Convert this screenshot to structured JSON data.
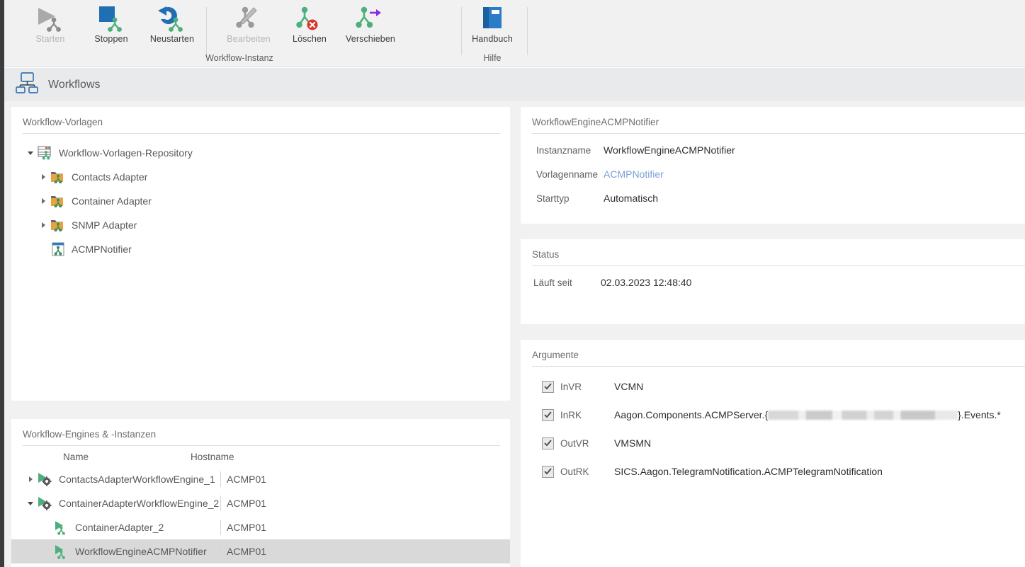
{
  "ribbon": {
    "groups": [
      {
        "title": "Workflow-Instanz",
        "buttons": [
          {
            "label": "Starten",
            "icon": "play-workflow-icon",
            "disabled": true
          },
          {
            "label": "Stoppen",
            "icon": "stop-workflow-icon",
            "disabled": false
          },
          {
            "label": "Neustarten",
            "icon": "restart-workflow-icon",
            "disabled": false
          },
          {
            "label": "Bearbeiten",
            "icon": "edit-workflow-icon",
            "disabled": true
          },
          {
            "label": "Löschen",
            "icon": "delete-workflow-icon",
            "disabled": false
          },
          {
            "label": "Verschieben",
            "icon": "move-workflow-icon",
            "disabled": false
          }
        ]
      },
      {
        "title": "Hilfe",
        "buttons": [
          {
            "label": "Handbuch",
            "icon": "manual-book-icon",
            "disabled": false
          }
        ]
      }
    ]
  },
  "page_header": {
    "title": "Workflows",
    "icon": "workflow-hierarchy-icon"
  },
  "templates_panel": {
    "title": "Workflow-Vorlagen",
    "tree": [
      {
        "label": "Workflow-Vorlagen-Repository",
        "icon": "repository-icon",
        "expander": "down",
        "level": 0
      },
      {
        "label": "Contacts Adapter",
        "icon": "folder-workflow-icon",
        "expander": "right",
        "level": 1
      },
      {
        "label": "Container Adapter",
        "icon": "folder-workflow-icon",
        "expander": "right",
        "level": 1
      },
      {
        "label": "SNMP Adapter",
        "icon": "folder-workflow-icon",
        "expander": "right",
        "level": 1
      },
      {
        "label": "ACMPNotifier",
        "icon": "workflow-template-icon",
        "expander": "none",
        "level": 1
      }
    ]
  },
  "engines_panel": {
    "title": "Workflow-Engines & -Instanzen",
    "columns": {
      "name": "Name",
      "hostname": "Hostname"
    },
    "rows": [
      {
        "name": "ContactsAdapterWorkflowEngine_1",
        "hostname": "ACMP01",
        "icon": "engine-running-icon",
        "expander": "right",
        "level": 0,
        "selected": false
      },
      {
        "name": "ContainerAdapterWorkflowEngine_2",
        "hostname": "ACMP01",
        "icon": "engine-running-icon",
        "expander": "down",
        "level": 0,
        "selected": false
      },
      {
        "name": "ContainerAdapter_2",
        "hostname": "ACMP01",
        "icon": "instance-running-icon",
        "expander": "none",
        "level": 1,
        "selected": false
      },
      {
        "name": "WorkflowEngineACMPNotifier",
        "hostname": "ACMP01",
        "icon": "instance-running-icon",
        "expander": "none",
        "level": 1,
        "selected": true
      }
    ]
  },
  "instance_panel": {
    "title": "WorkflowEngineACMPNotifier",
    "fields": [
      {
        "label": "Instanzname",
        "value": "WorkflowEngineACMPNotifier",
        "link": false
      },
      {
        "label": "Vorlagenname",
        "value": "ACMPNotifier",
        "link": true
      },
      {
        "label": "Starttyp",
        "value": "Automatisch",
        "link": false
      }
    ]
  },
  "status_panel": {
    "title": "Status",
    "fields": [
      {
        "label": "Läuft seit",
        "value": "02.03.2023 12:48:40"
      }
    ]
  },
  "arguments_panel": {
    "title": "Argumente",
    "rows": [
      {
        "name": "InVR",
        "checked": true,
        "value_prefix": "VCMN",
        "redacted": false,
        "value_suffix": ""
      },
      {
        "name": "InRK",
        "checked": true,
        "value_prefix": "Aagon.Components.ACMPServer.{",
        "redacted": true,
        "value_suffix": "}.Events.*"
      },
      {
        "name": "OutVR",
        "checked": true,
        "value_prefix": "VMSMN",
        "redacted": false,
        "value_suffix": ""
      },
      {
        "name": "OutRK",
        "checked": true,
        "value_prefix": "SICS.Aagon.TelegramNotification.ACMPTelegramNotification",
        "redacted": false,
        "value_suffix": ""
      }
    ]
  },
  "colors": {
    "accent_blue": "#1f6fb2",
    "workflow_green": "#4caf7d",
    "link_blue": "#7b9fd6",
    "delete_red": "#d9352c",
    "move_purple": "#8a2be2",
    "folder_gold": "#e8a33d",
    "rail_dark": "#3c3c3c",
    "selection_gray": "#d9d9d9"
  }
}
